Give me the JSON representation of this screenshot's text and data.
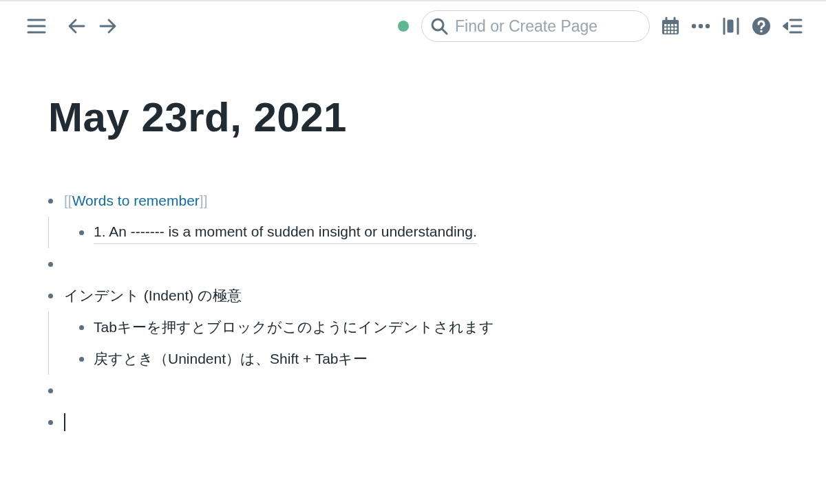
{
  "topbar": {
    "synced": true,
    "search": {
      "placeholder": "Find or Create Page"
    }
  },
  "page": {
    "title": "May 23rd, 2021",
    "blocks": [
      {
        "kind": "page-ref",
        "open": "[[",
        "text": "Words to remember",
        "close": "]]",
        "children": [
          {
            "kind": "text",
            "text": "1. An ------- is a moment of sudden insight or understanding.",
            "underlined": true
          }
        ]
      },
      {
        "kind": "empty"
      },
      {
        "kind": "text",
        "text": "インデント (Indent) の極意",
        "children": [
          {
            "kind": "text",
            "text": "Tabキーを押すとブロックがこのようにインデントされます"
          },
          {
            "kind": "text",
            "text": "戻すとき（Unindent）は、Shift + Tabキー"
          }
        ]
      },
      {
        "kind": "empty"
      },
      {
        "kind": "empty",
        "editing": true
      }
    ]
  }
}
